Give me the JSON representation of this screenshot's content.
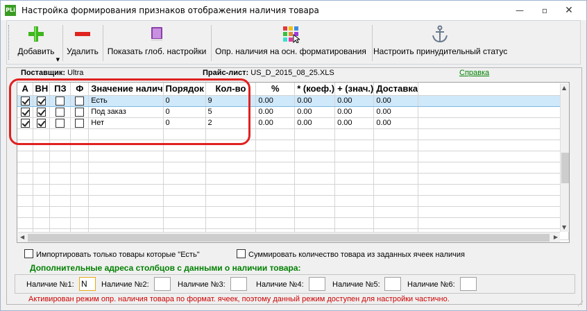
{
  "window": {
    "title": "Настройка формирования признаков отображения наличия товара",
    "app_icon": "PLi",
    "minimize": "—",
    "maximize": "▫",
    "close": "✕"
  },
  "toolbar": {
    "add_label": "Добавить",
    "delete_label": "Удалить",
    "global_settings_label": "Показать глоб. настройки",
    "formatting_label": "Опр. наличия на осн. форматирования",
    "forced_status_label": "Настроить принудительный статус"
  },
  "info": {
    "supplier_label": "Поставщик:",
    "supplier_value": "Ultra",
    "pricelist_label": "Прайс-лист:",
    "pricelist_value": "US_D_2015_08_25.XLS",
    "help_link": "Справка"
  },
  "grid": {
    "columns": [
      "А",
      "ВН",
      "ПЗ",
      "Ф",
      "Значение налич",
      "Порядок",
      "Кол-во",
      "%",
      "* (коеф.)",
      "+ (знач.)",
      "Доставка"
    ],
    "rows": [
      {
        "a": true,
        "vn": true,
        "pz": false,
        "f": false,
        "value": "Есть",
        "order": "0",
        "qty": "9",
        "pct": "0.00",
        "coef": "0.00",
        "plus": "0.00",
        "delivery": "0.00"
      },
      {
        "a": true,
        "vn": true,
        "pz": false,
        "f": false,
        "value": "Под заказ",
        "order": "0",
        "qty": "5",
        "pct": "0.00",
        "coef": "0.00",
        "plus": "0.00",
        "delivery": "0.00"
      },
      {
        "a": true,
        "vn": true,
        "pz": false,
        "f": false,
        "value": "Нет",
        "order": "0",
        "qty": "2",
        "pct": "0.00",
        "coef": "0.00",
        "plus": "0.00",
        "delivery": "0.00"
      }
    ]
  },
  "options": {
    "import_only_label": "Импортировать только товары которые \"Есть\"",
    "sum_qty_label": "Суммировать количество товара из заданных ячеек наличия"
  },
  "addresses": {
    "title": "Дополнительные адреса столбцов с данными о наличии товара:",
    "fields": [
      {
        "label": "Наличие №1:",
        "value": "N"
      },
      {
        "label": "Наличие №2:",
        "value": ""
      },
      {
        "label": "Наличие №3:",
        "value": ""
      },
      {
        "label": "Наличие №4:",
        "value": ""
      },
      {
        "label": "Наличие №5:",
        "value": ""
      },
      {
        "label": "Наличие №6:",
        "value": ""
      }
    ]
  },
  "status_message": "Активирован режим опр. наличия товара по формат. ячеек, поэтому данный режим доступен для настройки частично.",
  "colors": {
    "accent_green": "#008000",
    "warning_red": "#cc0000",
    "selection": "#cfe8fa",
    "highlight_outline": "#e02020"
  },
  "icons": [
    "plus-icon",
    "minus-icon",
    "book-icon",
    "color-grid-icon",
    "anchor-icon"
  ]
}
